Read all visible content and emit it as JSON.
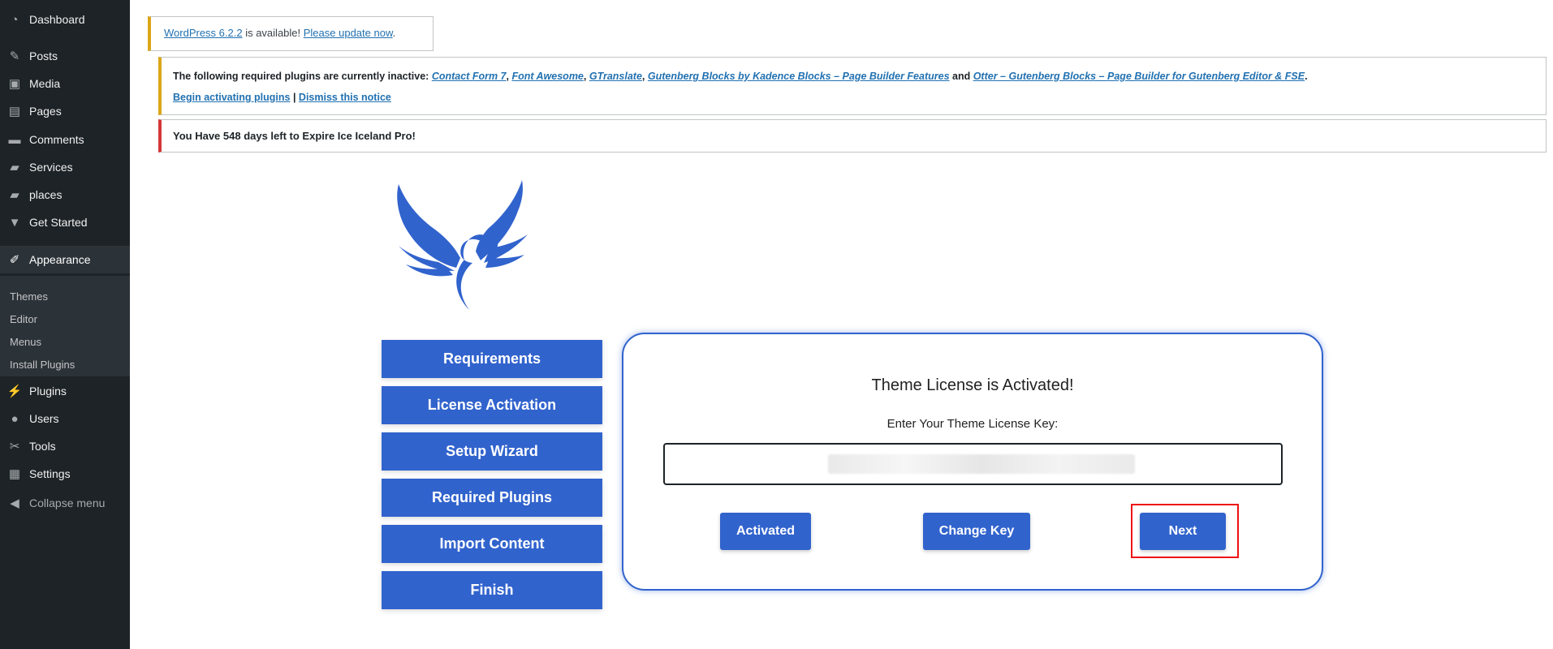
{
  "sidebar": {
    "items": [
      {
        "label": "Dashboard",
        "icon": "dashboard-icon",
        "glyph": "◔"
      },
      {
        "label": "Posts",
        "icon": "pushpin-icon",
        "glyph": "✎"
      },
      {
        "label": "Media",
        "icon": "media-icon",
        "glyph": "▣"
      },
      {
        "label": "Pages",
        "icon": "pages-icon",
        "glyph": "▤"
      },
      {
        "label": "Comments",
        "icon": "comments-icon",
        "glyph": "▬"
      },
      {
        "label": "Services",
        "icon": "folder-icon",
        "glyph": "▰"
      },
      {
        "label": "places",
        "icon": "folder-icon",
        "glyph": "▰"
      },
      {
        "label": "Get Started",
        "icon": "chevron-down-icon",
        "glyph": "▼"
      },
      {
        "label": "Appearance",
        "icon": "paintbrush-icon",
        "glyph": "✐"
      },
      {
        "label": "Plugins",
        "icon": "plugin-icon",
        "glyph": "⚡"
      },
      {
        "label": "Users",
        "icon": "user-icon",
        "glyph": "●"
      },
      {
        "label": "Tools",
        "icon": "wrench-icon",
        "glyph": "✂"
      },
      {
        "label": "Settings",
        "icon": "settings-icon",
        "glyph": "▦"
      },
      {
        "label": "Collapse menu",
        "icon": "collapse-icon",
        "glyph": "◀"
      }
    ],
    "submenu": [
      "Themes",
      "Editor",
      "Menus",
      "Install Plugins"
    ]
  },
  "notices": {
    "update": {
      "link1": "WordPress 6.2.2",
      "text": " is available! ",
      "link2": "Please update now",
      "end": "."
    },
    "plugins": {
      "intro": "The following required plugins are currently inactive: ",
      "plugins": [
        "Contact Form 7",
        "Font Awesome",
        "GTranslate",
        "Gutenberg Blocks by Kadence Blocks – Page Builder Features",
        "Otter – Gutenberg Blocks – Page Builder for Gutenberg Editor & FSE"
      ],
      "sep": ", ",
      "and": " and ",
      "end": ".",
      "begin": "Begin activating plugins",
      "divider": " | ",
      "dismiss": "Dismiss this notice"
    },
    "expire": "You Have 548 days left to Expire Ice Iceland Pro!"
  },
  "steps": [
    "Requirements",
    "License Activation",
    "Setup Wizard",
    "Required Plugins",
    "Import Content",
    "Finish"
  ],
  "license": {
    "title": "Theme License is Activated!",
    "label": "Enter Your Theme License Key:",
    "value": "E",
    "btn_activated": "Activated",
    "btn_change": "Change Key",
    "btn_next": "Next"
  },
  "colors": {
    "primary": "#3163cd",
    "sidebar": "#1d2327",
    "warning": "#dba617",
    "error": "#d63638",
    "highlight": "#ee1111"
  }
}
